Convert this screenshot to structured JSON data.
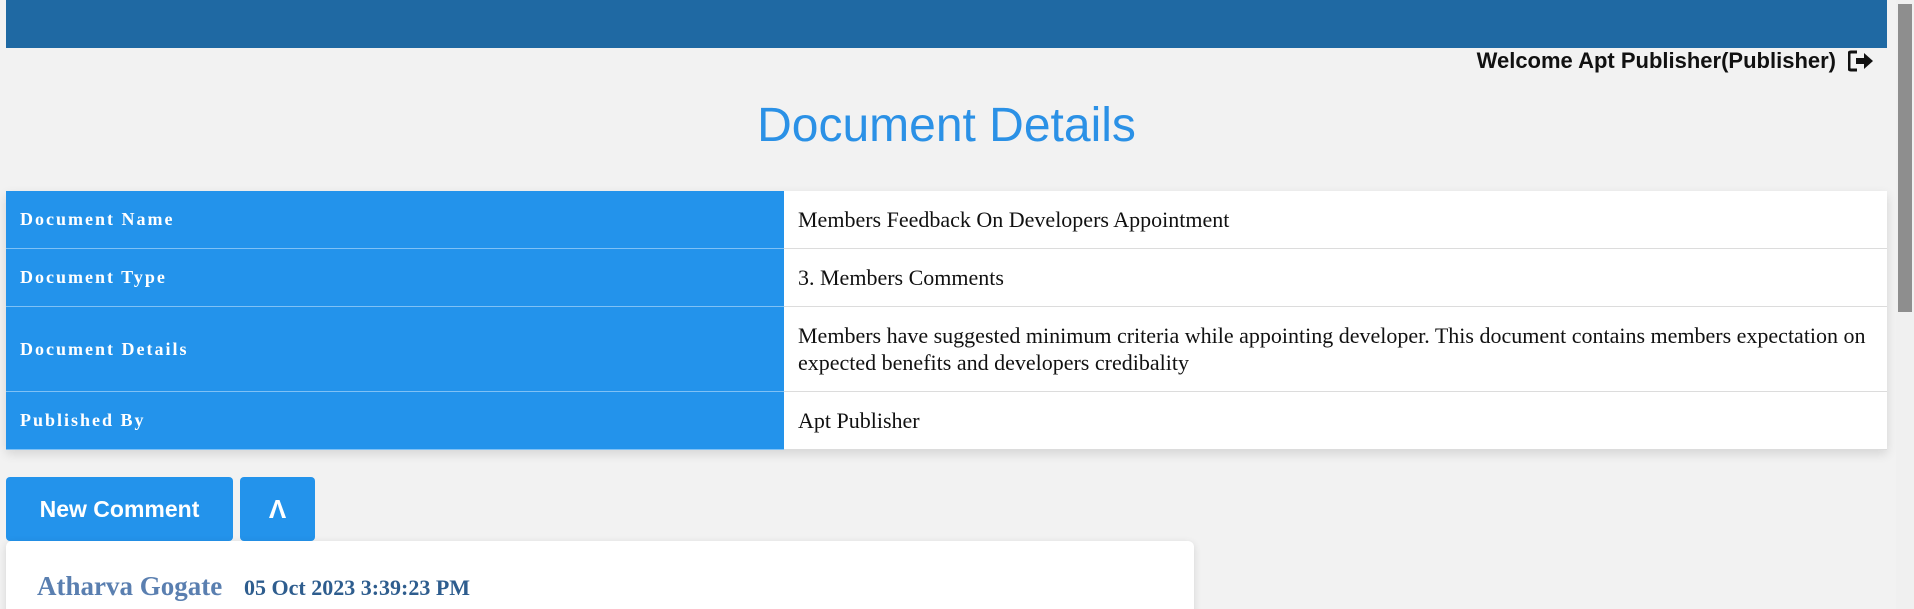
{
  "header": {
    "welcome_text": "Welcome Apt Publisher(Publisher)",
    "logout_icon": "sign-out-icon",
    "bar_color": "#1f69a3"
  },
  "page_title": "Document Details",
  "details": {
    "rows": [
      {
        "label": "Document Name",
        "value": "Members Feedback On Developers Appointment"
      },
      {
        "label": "Document Type",
        "value": "3. Members Comments"
      },
      {
        "label": "Document Details",
        "value": "Members have suggested minimum criteria while appointing developer. This document contains members expectation on expected benefits and developers credibality"
      },
      {
        "label": "Published By",
        "value": "Apt Publisher"
      }
    ],
    "label_color": "#2393eb"
  },
  "actions": {
    "new_comment_label": "New Comment",
    "collapse_label": "Λ"
  },
  "comments": [
    {
      "author": "Atharva Gogate",
      "timestamp": "05 Oct 2023 3:39:23 PM"
    }
  ]
}
